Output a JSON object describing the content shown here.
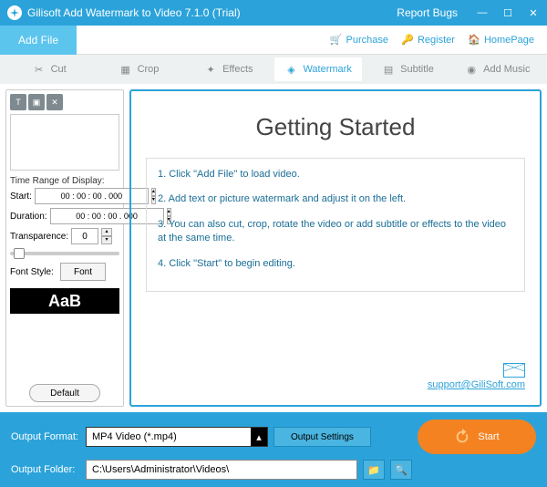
{
  "titlebar": {
    "title": "Gilisoft Add Watermark to Video 7.1.0 (Trial)",
    "report": "Report Bugs"
  },
  "toolbar": {
    "add_file": "Add File",
    "purchase": "Purchase",
    "register": "Register",
    "homepage": "HomePage"
  },
  "tabs": {
    "cut": "Cut",
    "crop": "Crop",
    "effects": "Effects",
    "watermark": "Watermark",
    "subtitle": "Subtitle",
    "music": "Add Music"
  },
  "sidebar": {
    "time_range": "Time Range of Display:",
    "start_label": "Start:",
    "start_value": "00 : 00 : 00 . 000",
    "duration_label": "Duration:",
    "duration_value": "00 : 00 : 00 . 000",
    "transparence_label": "Transparence:",
    "transparence_value": "0",
    "font_style": "Font Style:",
    "font_btn": "Font",
    "sample": "AaB",
    "default_btn": "Default"
  },
  "main": {
    "heading": "Getting Started",
    "step1": "1. Click \"Add File\" to load video.",
    "step2": "2. Add text or picture watermark and adjust it on the left.",
    "step3": "3. You can also cut, crop, rotate the video or add subtitle or effects to the video at the same time.",
    "step4": "4. Click \"Start\" to begin editing.",
    "support": "support@GiliSoft.com"
  },
  "footer": {
    "format_label": "Output Format:",
    "format_value": "MP4 Video (*.mp4)",
    "settings_btn": "Output Settings",
    "folder_label": "Output Folder:",
    "folder_value": "C:\\Users\\Administrator\\Videos\\",
    "start": "Start"
  }
}
